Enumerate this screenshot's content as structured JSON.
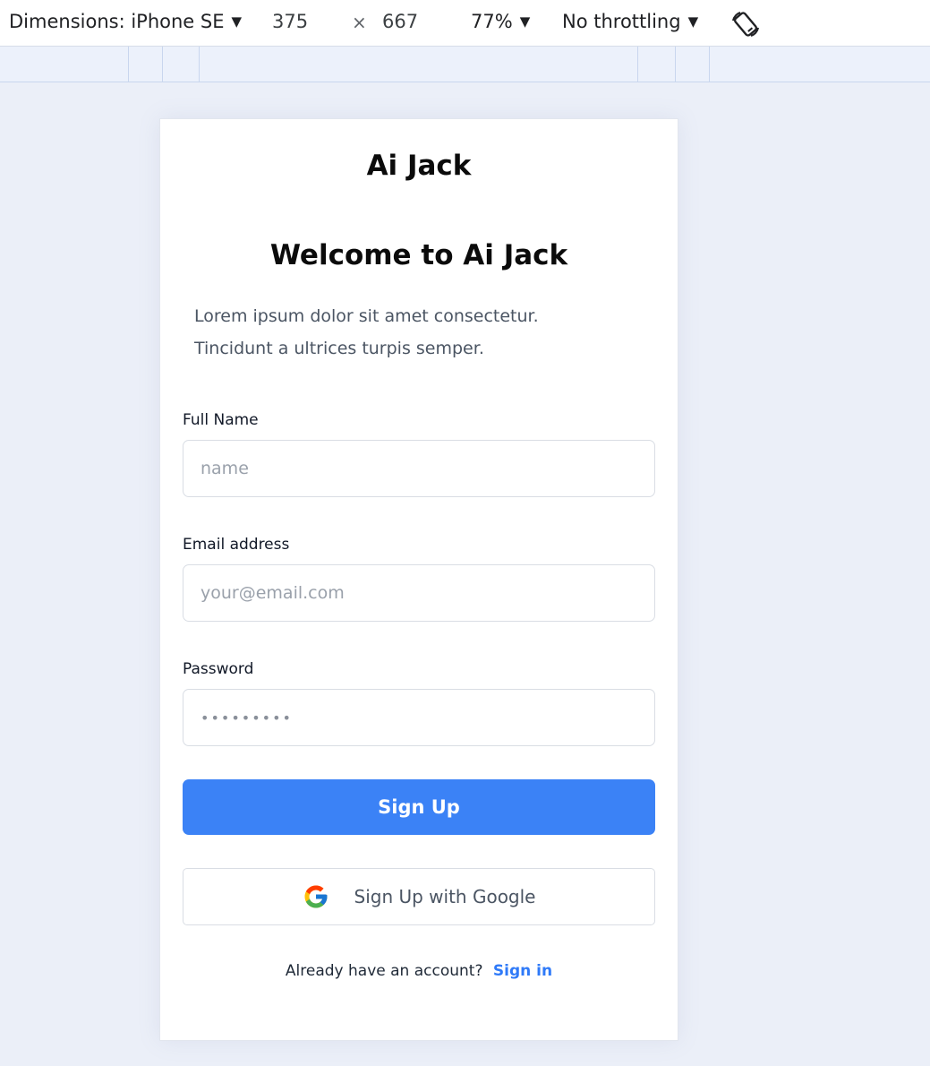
{
  "devtools": {
    "dimensions_label": "Dimensions: iPhone SE",
    "width_value": "375",
    "times_symbol": "×",
    "height_value": "667",
    "zoom_value": "77%",
    "throttling_value": "No throttling",
    "caret": "▼"
  },
  "page": {
    "brand": "Ai Jack",
    "welcome_title": "Welcome to Ai Jack",
    "intro_line1": "Lorem ipsum dolor sit amet consectetur.",
    "intro_line2": "Tincidunt a ultrices turpis semper."
  },
  "form": {
    "full_name_label": "Full Name",
    "full_name_placeholder": "name",
    "email_label": "Email address",
    "email_placeholder": "your@email.com",
    "password_label": "Password",
    "password_placeholder": "•••••••••",
    "signup_label": "Sign Up",
    "google_label": "Sign Up with Google"
  },
  "footer": {
    "prompt": "Already have an account?",
    "signin_label": "Sign in"
  },
  "colors": {
    "primary": "#3b82f6",
    "link": "#2f7af8",
    "viewport_bg": "#ebeff8"
  }
}
